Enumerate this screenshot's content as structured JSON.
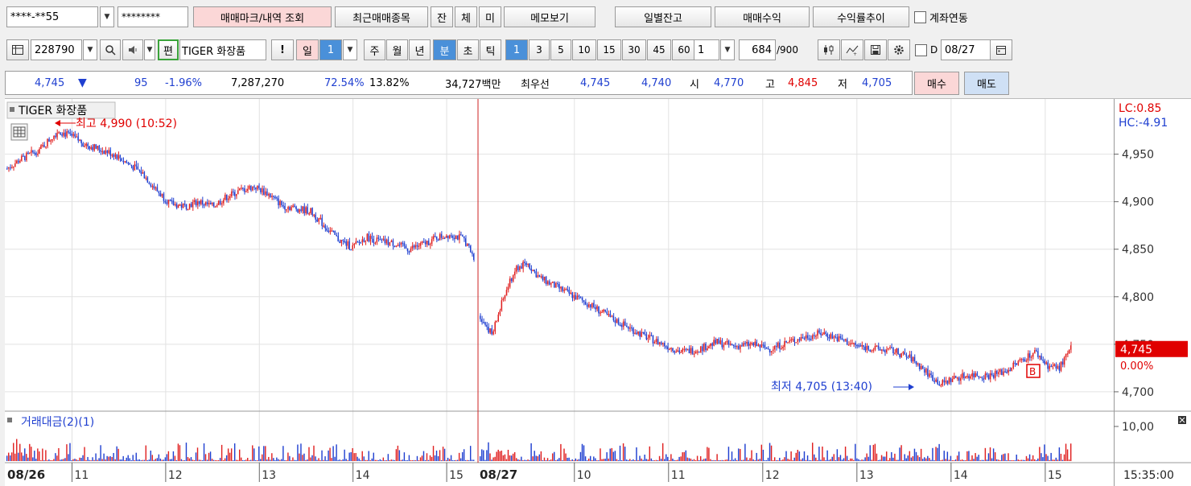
{
  "toolbar1": {
    "account": "****-**55",
    "password": "********",
    "trade_mark_button": "매매마크/내역 조회",
    "recent_items_button": "최근매매종목",
    "btn_jan": "잔",
    "btn_che": "체",
    "btn_mi": "미",
    "memo_button": "메모보기",
    "daily_balance_button": "일별잔고",
    "trade_profit_button": "매매수익",
    "return_trend_button": "수익률추이",
    "account_link_label": "계좌연동"
  },
  "toolbar2": {
    "code": "228790",
    "edit_label": "편",
    "name": "TIGER 화장품",
    "alert_label": "!",
    "day_label": "일",
    "day_value": "1",
    "periods": [
      "주",
      "월",
      "년",
      "분",
      "초",
      "틱"
    ],
    "active_period": "분",
    "minute_value": "1",
    "intervals": [
      "3",
      "5",
      "10",
      "15",
      "30",
      "45",
      "60"
    ],
    "count_value": "1",
    "bars_count": "684",
    "bars_max": "/900",
    "d_label": "D",
    "date_value": "08/27"
  },
  "quote": {
    "price": "4,745",
    "arrow": "▼",
    "change": "95",
    "change_pct": "-1.96%",
    "volume": "7,287,270",
    "vol_ratio": "72.54%",
    "turnover": "13.82%",
    "amount": "34,727백만",
    "best_label": "최우선",
    "ask": "4,745",
    "bid": "4,740",
    "open_label": "시",
    "open": "4,770",
    "high_label": "고",
    "high": "4,845",
    "low_label": "저",
    "low": "4,705",
    "buy_button": "매수",
    "sell_button": "매도"
  },
  "chart_data": {
    "type": "line",
    "title": "TIGER 화장품",
    "price_axis_ticks": [
      "4,950",
      "4,900",
      "4,850",
      "4,800",
      "4,750",
      "4,700"
    ],
    "price_tick_values": [
      4950,
      4900,
      4850,
      4800,
      4750,
      4700
    ],
    "ylim": [
      4683,
      5003
    ],
    "lc_label": "LC:0.85",
    "hc_label": "HC:-4.91",
    "current_price_label": "4,745",
    "current_pct_label": "0.00%",
    "current_price": 4745,
    "high_annotation": "최고 4,990 (10:52)",
    "low_annotation": "최저 4,705 (13:40)",
    "day1_label": "08/26",
    "day2_label": "08/27",
    "day1_hours": [
      "11",
      "12",
      "13",
      "14",
      "15"
    ],
    "day2_hours": [
      "10",
      "11",
      "12",
      "13",
      "14",
      "15"
    ],
    "clock": "15:35:00",
    "volume_panel_title": "거래대금(2)(1)",
    "volume_axis_tick": "10,00",
    "b_marker": "B",
    "price_path_day1": [
      [
        0,
        4935
      ],
      [
        0.03,
        4945
      ],
      [
        0.07,
        4955
      ],
      [
        0.11,
        4975
      ],
      [
        0.14,
        4968
      ],
      [
        0.17,
        4960
      ],
      [
        0.2,
        4955
      ],
      [
        0.23,
        4950
      ],
      [
        0.26,
        4940
      ],
      [
        0.29,
        4930
      ],
      [
        0.32,
        4912
      ],
      [
        0.35,
        4898
      ],
      [
        0.38,
        4895
      ],
      [
        0.41,
        4900
      ],
      [
        0.44,
        4895
      ],
      [
        0.47,
        4905
      ],
      [
        0.5,
        4912
      ],
      [
        0.53,
        4916
      ],
      [
        0.56,
        4908
      ],
      [
        0.59,
        4896
      ],
      [
        0.62,
        4893
      ],
      [
        0.65,
        4890
      ],
      [
        0.68,
        4875
      ],
      [
        0.71,
        4860
      ],
      [
        0.74,
        4852
      ],
      [
        0.77,
        4863
      ],
      [
        0.8,
        4858
      ],
      [
        0.83,
        4856
      ],
      [
        0.86,
        4850
      ],
      [
        0.89,
        4855
      ],
      [
        0.92,
        4862
      ],
      [
        0.95,
        4866
      ],
      [
        0.98,
        4860
      ],
      [
        1.0,
        4840
      ]
    ],
    "price_path_day2": [
      [
        0,
        4780
      ],
      [
        0.02,
        4760
      ],
      [
        0.04,
        4800
      ],
      [
        0.06,
        4830
      ],
      [
        0.08,
        4835
      ],
      [
        0.1,
        4820
      ],
      [
        0.13,
        4810
      ],
      [
        0.16,
        4800
      ],
      [
        0.19,
        4790
      ],
      [
        0.22,
        4778
      ],
      [
        0.25,
        4768
      ],
      [
        0.28,
        4758
      ],
      [
        0.31,
        4750
      ],
      [
        0.34,
        4742
      ],
      [
        0.37,
        4745
      ],
      [
        0.4,
        4752
      ],
      [
        0.43,
        4748
      ],
      [
        0.46,
        4750
      ],
      [
        0.49,
        4745
      ],
      [
        0.52,
        4752
      ],
      [
        0.55,
        4758
      ],
      [
        0.58,
        4762
      ],
      [
        0.61,
        4755
      ],
      [
        0.64,
        4748
      ],
      [
        0.67,
        4745
      ],
      [
        0.7,
        4743
      ],
      [
        0.73,
        4735
      ],
      [
        0.76,
        4718
      ],
      [
        0.78,
        4708
      ],
      [
        0.8,
        4714
      ],
      [
        0.83,
        4718
      ],
      [
        0.86,
        4717
      ],
      [
        0.89,
        4722
      ],
      [
        0.92,
        4735
      ],
      [
        0.94,
        4742
      ],
      [
        0.96,
        4728
      ],
      [
        0.98,
        4725
      ],
      [
        1.0,
        4745
      ]
    ]
  }
}
